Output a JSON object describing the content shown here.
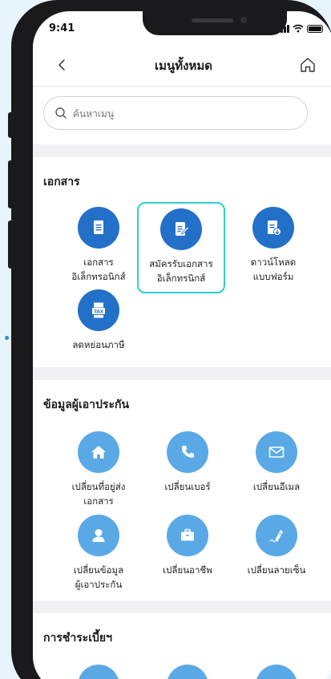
{
  "status": {
    "time": "9:41"
  },
  "header": {
    "title": "เมนูทั้งหมด"
  },
  "search": {
    "placeholder": "ค้นหาเมนู"
  },
  "sections": [
    {
      "title": "เอกสาร",
      "items": [
        {
          "line1": "เอกสาร",
          "line2": "อิเล็กทรอนิกส์",
          "icon": "document-icon"
        },
        {
          "line1": "สมัครรับเอกสาร",
          "line2": "อิเล็กทรนิกส์",
          "icon": "edit-document-icon"
        },
        {
          "line1": "ดาวน์โหลด",
          "line2": "แบบฟอร์ม",
          "icon": "download-document-icon"
        },
        {
          "line1": "ลดหย่อนภาษี",
          "line2": "",
          "icon": "tax-icon"
        }
      ]
    },
    {
      "title": "ข้อมูลผู้เอาประกัน",
      "items": [
        {
          "line1": "เปลี่ยนที่อยู่ส่ง",
          "line2": "เอกสาร",
          "icon": "home-icon"
        },
        {
          "line1": "เปลี่ยนเบอร์",
          "line2": "",
          "icon": "phone-icon"
        },
        {
          "line1": "เปลี่ยนอีเมล",
          "line2": "",
          "icon": "mail-icon"
        },
        {
          "line1": "เปลี่ยนข้อมูล",
          "line2": "ผู้เอาประกัน",
          "icon": "user-icon"
        },
        {
          "line1": "เปลี่ยนอาชีพ",
          "line2": "",
          "icon": "briefcase-icon"
        },
        {
          "line1": "เปลี่ยนลายเซ็น",
          "line2": "",
          "icon": "signature-pen-icon"
        }
      ]
    },
    {
      "title": "การชำระเบี้ยฯ"
    }
  ],
  "colors": {
    "dark_icon": "#2370c8",
    "light_icon": "#5aa9e6",
    "highlight": "#2ccfd0"
  }
}
